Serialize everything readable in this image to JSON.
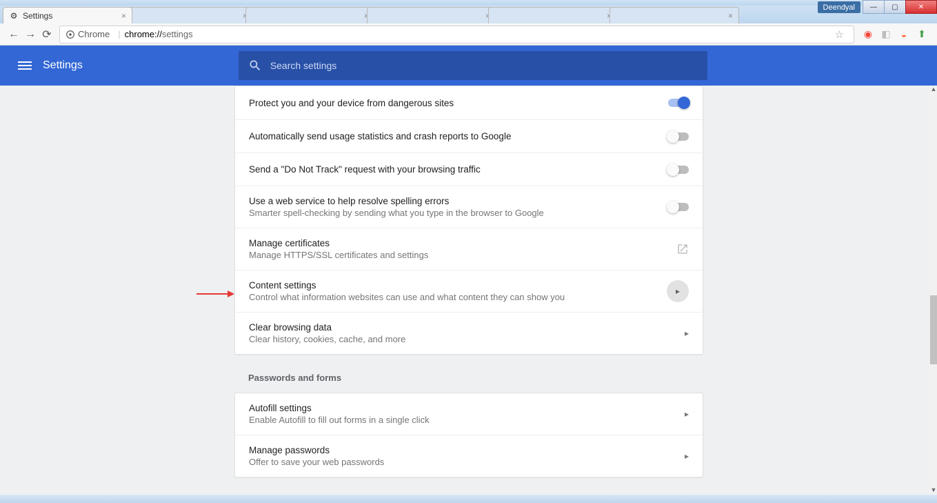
{
  "window": {
    "user": "Deendyal"
  },
  "tabs": {
    "active_title": "Settings"
  },
  "omnibox": {
    "security_label": "Chrome",
    "url_scheme": "chrome://",
    "url_path": "settings"
  },
  "header": {
    "title": "Settings",
    "search_placeholder": "Search settings"
  },
  "privacy": {
    "rows": [
      {
        "label": "Protect you and your device from dangerous sites",
        "sub": "",
        "toggle": "on"
      },
      {
        "label": "Automatically send usage statistics and crash reports to Google",
        "sub": "",
        "toggle": "off"
      },
      {
        "label": "Send a \"Do Not Track\" request with your browsing traffic",
        "sub": "",
        "toggle": "off"
      },
      {
        "label": "Use a web service to help resolve spelling errors",
        "sub": "Smarter spell-checking by sending what you type in the browser to Google",
        "toggle": "off"
      },
      {
        "label": "Manage certificates",
        "sub": "Manage HTTPS/SSL certificates and settings",
        "kind": "external"
      },
      {
        "label": "Content settings",
        "sub": "Control what information websites can use and what content they can show you",
        "kind": "chev-circle"
      },
      {
        "label": "Clear browsing data",
        "sub": "Clear history, cookies, cache, and more",
        "kind": "chev"
      }
    ]
  },
  "passwords": {
    "section_title": "Passwords and forms",
    "rows": [
      {
        "label": "Autofill settings",
        "sub": "Enable Autofill to fill out forms in a single click",
        "kind": "chev"
      },
      {
        "label": "Manage passwords",
        "sub": "Offer to save your web passwords",
        "kind": "chev"
      }
    ]
  }
}
